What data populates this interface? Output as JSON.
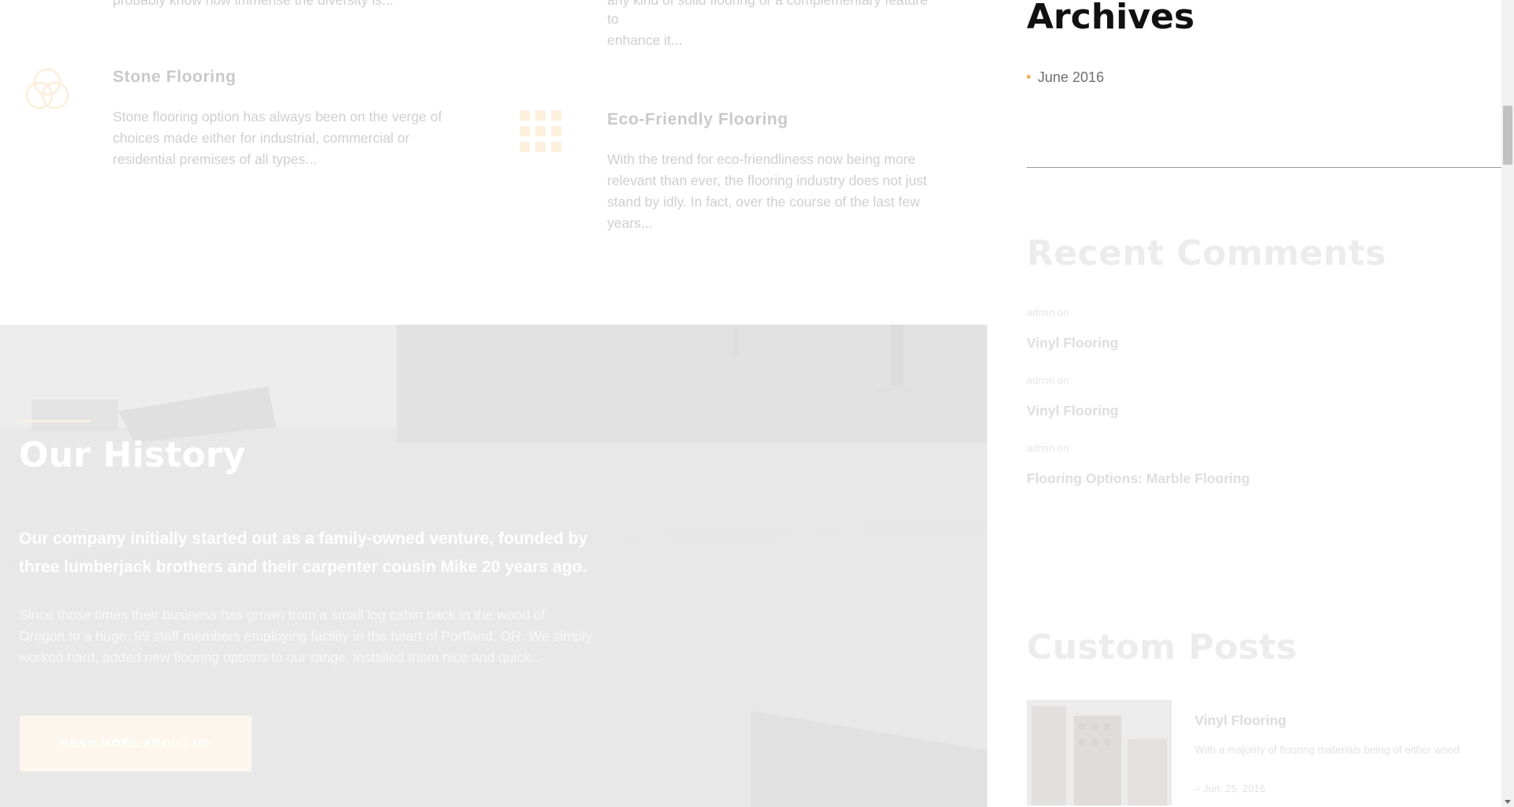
{
  "features": {
    "partial_left_text": "probably know how immense the diversity is...",
    "partial_right_lines": [
      "any kind of solid flooring or a complementary feature",
      "to",
      "enhance it..."
    ],
    "stone": {
      "title": "Stone Flooring",
      "lines": [
        "Stone flooring option has always been on the verge of",
        "choices made either for industrial, commercial or",
        "residential premises of all types..."
      ],
      "icon": "rings-icon"
    },
    "eco": {
      "title": "Eco-Friendly Flooring",
      "lines": [
        "With the trend for eco-friendliness now being more",
        "relevant than ever, the flooring industry does not just",
        "stand by idly. In fact, over the course of the last few",
        "years..."
      ],
      "icon": "grid-icon"
    },
    "accent_color": "#f7dfb8"
  },
  "history": {
    "title": "Our History",
    "lead_lines": [
      "Our company initially started out as a family-owned venture, founded by",
      "three lumberjack brothers and their carpenter cousin Mike 20 years ago."
    ],
    "body_lines": [
      "Since those times their business has grown from a small log cabin back in the wood of",
      "Oregon to a huge, 99 staff members employing facility in the heart of Portland, OR. We simply",
      "worked hard, added new flooring options to our range, installed them nice and quick..."
    ],
    "button_label": "READ MORE ABOUT US"
  },
  "sidebar": {
    "archives": {
      "title": "Archives",
      "items": [
        "June 2016"
      ]
    },
    "recent_comments": {
      "title": "Recent Comments",
      "items": [
        {
          "author": "admin",
          "on": "on",
          "post": "Vinyl Flooring"
        },
        {
          "author": "admin",
          "on": "on",
          "post": "Vinyl Flooring"
        },
        {
          "author": "admin",
          "on": "on",
          "post": "Flooring Options: Marble Flooring"
        }
      ]
    },
    "custom_posts": {
      "title": "Custom Posts",
      "items": [
        {
          "title": "Vinyl Flooring",
          "excerpt": "With a majority of flooring materials being of either wood",
          "date": "– Jun. 25, 2016"
        }
      ]
    }
  },
  "colors": {
    "bullet": "#f0b05c",
    "button_bg": "#fdf6ec"
  }
}
